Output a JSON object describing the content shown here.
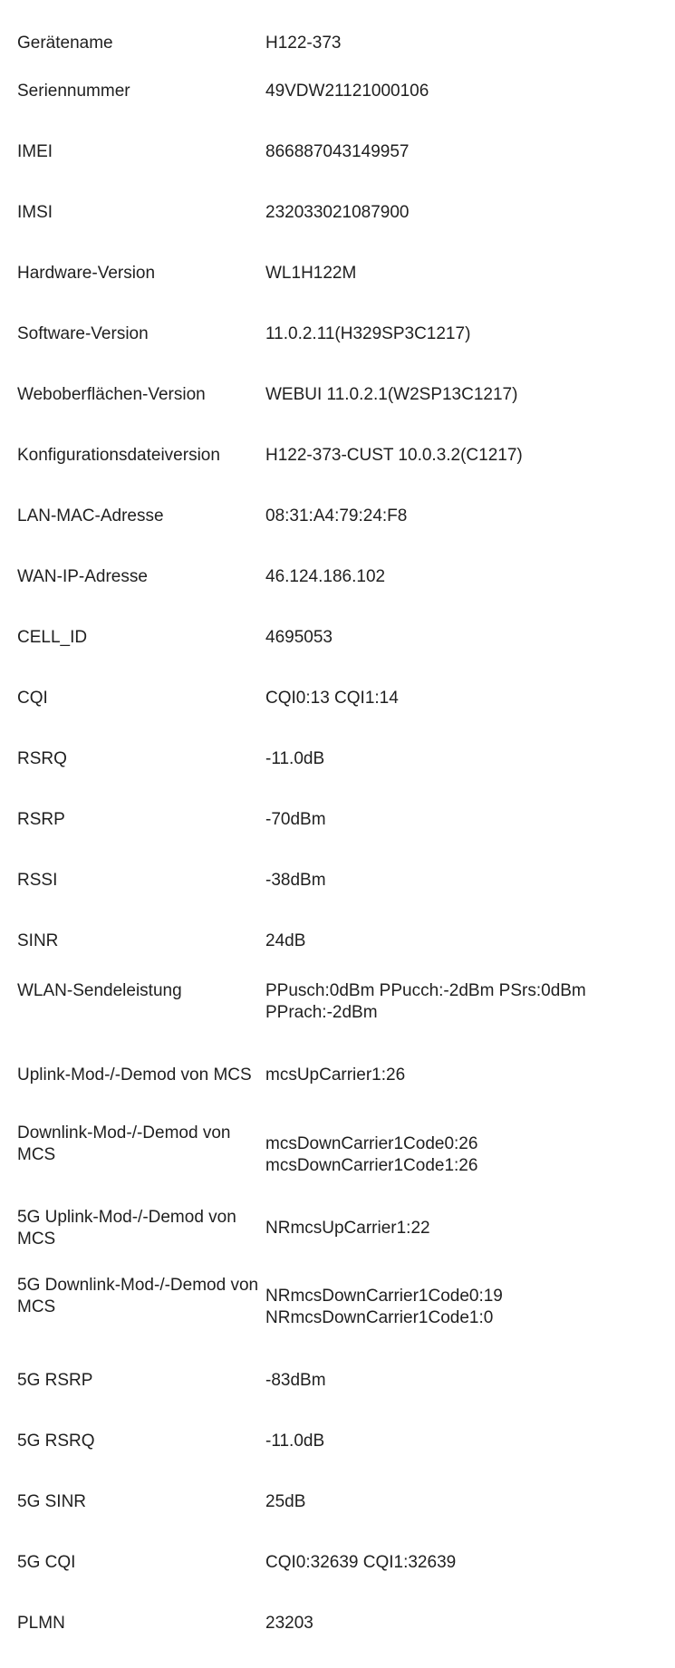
{
  "rows": [
    {
      "label": "Gerätename",
      "value": "H122-373"
    },
    {
      "label": "Seriennummer",
      "value": "49VDW21121000106"
    },
    {
      "label": "IMEI",
      "value": "866887043149957"
    },
    {
      "label": "IMSI",
      "value": "232033021087900"
    },
    {
      "label": "Hardware-Version",
      "value": "WL1H122M"
    },
    {
      "label": "Software-Version",
      "value": "11.0.2.11(H329SP3C1217)"
    },
    {
      "label": "Weboberflächen-Version",
      "value": "WEBUI 11.0.2.1(W2SP13C1217)"
    },
    {
      "label": "Konfigurationsdateiversion",
      "value": "H122-373-CUST 10.0.3.2(C1217)"
    },
    {
      "label": "LAN-MAC-Adresse",
      "value": "08:31:A4:79:24:F8"
    },
    {
      "label": "WAN-IP-Adresse",
      "value": "46.124.186.102"
    },
    {
      "label": "CELL_ID",
      "value": "4695053"
    },
    {
      "label": "CQI",
      "value": "CQI0:13 CQI1:14"
    },
    {
      "label": "RSRQ",
      "value": "-11.0dB"
    },
    {
      "label": "RSRP",
      "value": "-70dBm"
    },
    {
      "label": "RSSI",
      "value": "-38dBm"
    },
    {
      "label": "SINR",
      "value": "24dB"
    },
    {
      "label": "WLAN-Sendeleistung",
      "value": "PPusch:0dBm PPucch:-2dBm PSrs:0dBm PPrach:-2dBm"
    },
    {
      "label": "Uplink-Mod-/-Demod von MCS",
      "value": "mcsUpCarrier1:26"
    },
    {
      "label": "Downlink-Mod-/-Demod von MCS",
      "value": "mcsDownCarrier1Code0:26 mcsDownCarrier1Code1:26"
    },
    {
      "label": "5G Uplink-Mod-/-Demod von MCS",
      "value": "NRmcsUpCarrier1:22"
    },
    {
      "label": "5G Downlink-Mod-/-Demod von MCS",
      "value": "NRmcsDownCarrier1Code0:19 NRmcsDownCarrier1Code1:0"
    },
    {
      "label": "5G RSRP",
      "value": "-83dBm"
    },
    {
      "label": "5G RSRQ",
      "value": "-11.0dB"
    },
    {
      "label": "5G SINR",
      "value": "25dB"
    },
    {
      "label": "5G CQI",
      "value": "CQI0:32639 CQI1:32639"
    },
    {
      "label": "PLMN",
      "value": "23203"
    }
  ]
}
